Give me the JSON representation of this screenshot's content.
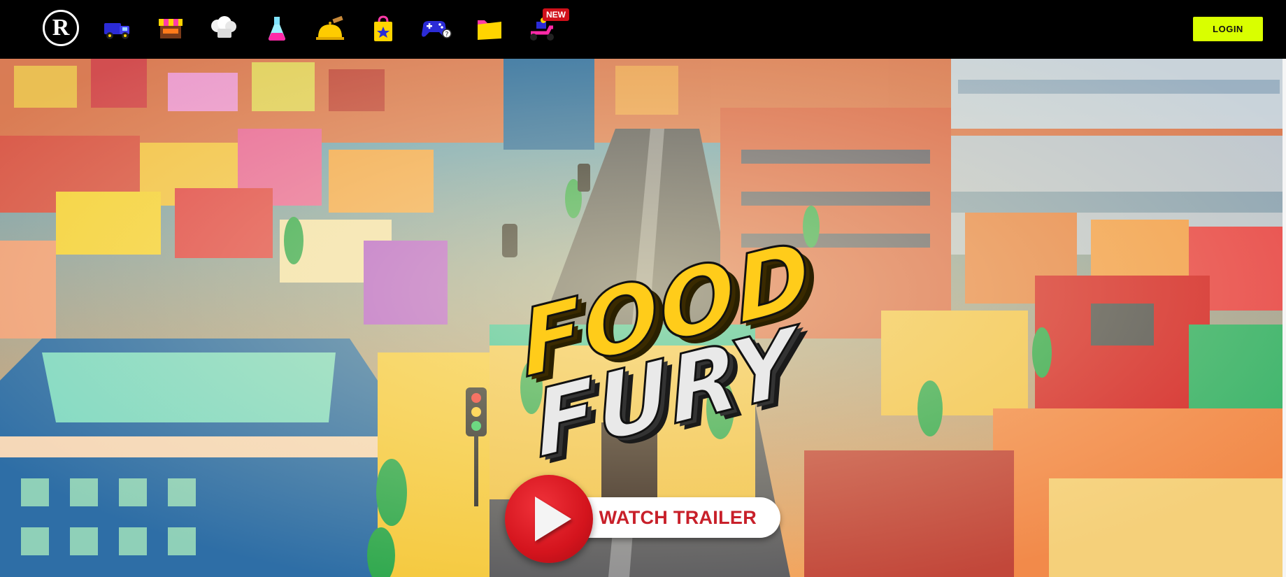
{
  "header": {
    "logo_letter": "R",
    "login_label": "LOGIN",
    "new_badge": "NEW",
    "nav_items": [
      {
        "icon": "truck-icon"
      },
      {
        "icon": "shop-stall-icon"
      },
      {
        "icon": "chef-hat-icon"
      },
      {
        "icon": "flask-icon"
      },
      {
        "icon": "service-bell-icon"
      },
      {
        "icon": "shopping-bag-icon"
      },
      {
        "icon": "gamepad-icon"
      },
      {
        "icon": "folder-icon"
      },
      {
        "icon": "scooter-icon"
      }
    ]
  },
  "hero": {
    "logo_line_1": "FOOD",
    "logo_line_2": "FURY",
    "trailer_label": "WATCH TRAILER"
  },
  "colors": {
    "accent": "#d9ff00",
    "trailer_red": "#d4141d",
    "logo_yellow": "#ffcc1a"
  }
}
